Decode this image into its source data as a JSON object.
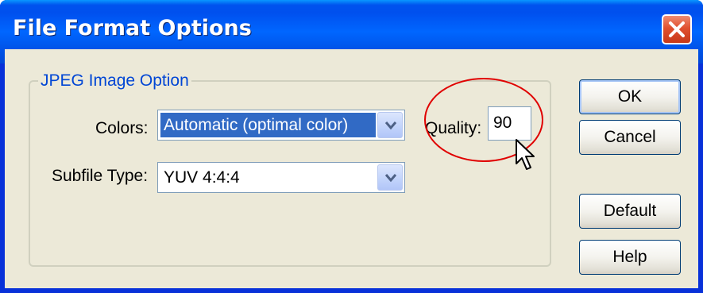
{
  "window": {
    "title": "File Format Options"
  },
  "group": {
    "legend": "JPEG Image Option"
  },
  "colors": {
    "label": "Colors:",
    "selected_value": "Automatic (optimal color)"
  },
  "subfile_type": {
    "label": "Subfile Type:",
    "selected_value": "YUV 4:4:4"
  },
  "quality": {
    "label": "Quality:",
    "value": "90"
  },
  "buttons": {
    "ok": "OK",
    "cancel": "Cancel",
    "default": "Default",
    "help": "Help"
  },
  "theme": {
    "titlebar_blue": "#0054e3",
    "close_red": "#e0502f",
    "dialog_face": "#ece9d8",
    "selection_blue": "#316ac5",
    "legend_blue": "#0046d5",
    "annotation_red": "#e00000"
  },
  "icons": {
    "close": "close-x-icon",
    "dropdown": "chevron-down-icon",
    "cursor": "mouse-pointer-icon"
  }
}
